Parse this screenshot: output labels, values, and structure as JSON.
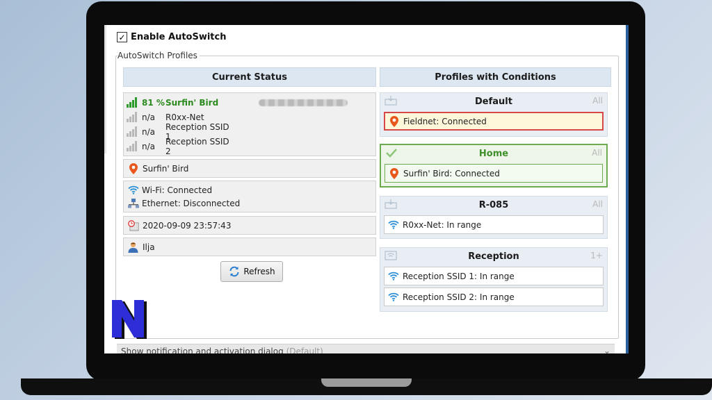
{
  "autoswitch": {
    "enable_label": "Enable AutoSwitch",
    "enabled": true,
    "group_label": "AutoSwitch Profiles"
  },
  "current_status": {
    "header": "Current Status",
    "networks": [
      {
        "signal": "81 %",
        "name": "Surfin' Bird",
        "strength": 4
      },
      {
        "signal": "n/a",
        "name": "R0xx-Net",
        "strength": 0
      },
      {
        "signal": "n/a",
        "name": "Reception SSID 1",
        "strength": 0
      },
      {
        "signal": "n/a",
        "name": "Reception SSID 2",
        "strength": 0
      }
    ],
    "location": "Surfin' Bird",
    "wifi": "Wi-Fi: Connected",
    "ethernet": "Ethernet: Disconnected",
    "datetime": "2020-09-09 23:57:43",
    "user": "Ilja",
    "refresh_label": "Refresh"
  },
  "profiles": {
    "header": "Profiles with Conditions",
    "items": [
      {
        "name": "Default",
        "badge": "All",
        "conditions": [
          "Fieldnet: Connected"
        ]
      },
      {
        "name": "Home",
        "badge": "All",
        "conditions": [
          "Surfin' Bird: Connected"
        ]
      },
      {
        "name": "R-085",
        "badge": "All",
        "conditions": [
          "R0xx-Net: In range"
        ]
      },
      {
        "name": "Reception",
        "badge": "1+",
        "conditions": [
          "Reception SSID 1: In range",
          "Reception SSID 2: In range"
        ]
      }
    ]
  },
  "footer": {
    "label": "Show notification and activation dialog",
    "hint": "(Default)"
  },
  "colors": {
    "header_bg": "#dde7f2",
    "active_green": "#3f8f2a",
    "error_red": "#d64848",
    "wifi_blue": "#2a8fd8",
    "pin_orange": "#e8581c"
  }
}
